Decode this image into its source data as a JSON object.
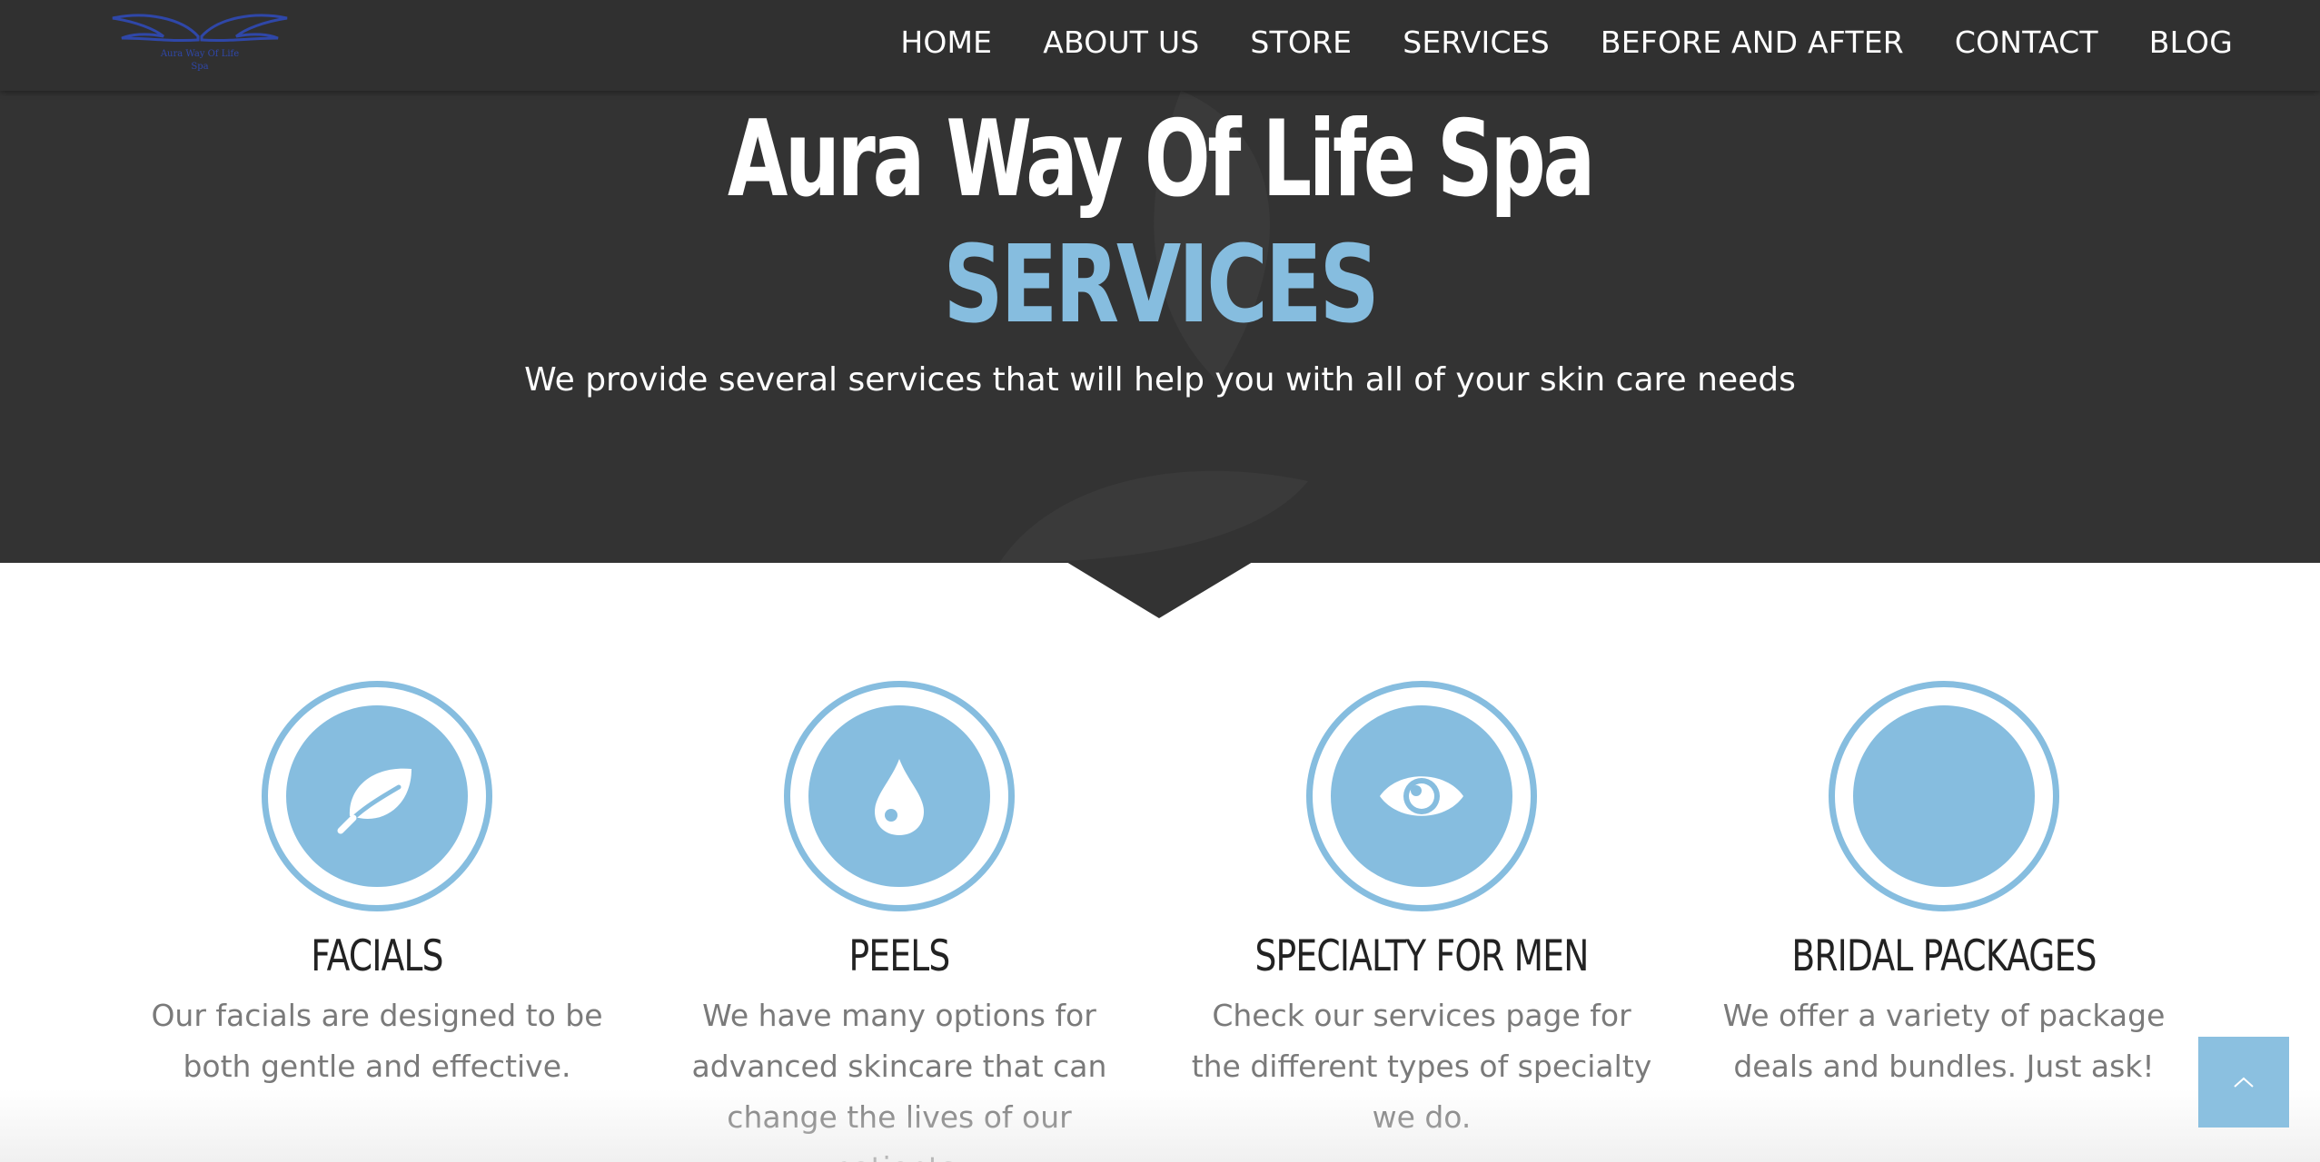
{
  "logo": {
    "line1": "Aura Way Of Life",
    "line2": "Spa"
  },
  "nav": {
    "items": [
      "HOME",
      "ABOUT US",
      "STORE",
      "SERVICES",
      "BEFORE AND AFTER",
      "CONTACT",
      "BLOG"
    ]
  },
  "hero": {
    "title": "Aura Way Of Life Spa",
    "subtitle": "SERVICES",
    "tagline": "We provide several services that will help you with all of your skin care needs"
  },
  "services": [
    {
      "icon": "leaf-icon",
      "title": "FACIALS",
      "description": "Our facials are designed to be both gentle and effective."
    },
    {
      "icon": "droplet-icon",
      "title": "PEELS",
      "description": "We have many options for advanced skincare that can change the lives of our patients."
    },
    {
      "icon": "eye-icon",
      "title": "SPECIALTY FOR MEN",
      "description": "Check our services page for the different types of specialty we do."
    },
    {
      "icon": "",
      "title": "BRIDAL PACKAGES",
      "description": "We offer a variety of package deals and bundles. Just ask!"
    }
  ],
  "colors": {
    "accent": "#86bddf",
    "hero_bg": "#333333",
    "heading": "#222222",
    "body_text": "#7a7a7a"
  }
}
